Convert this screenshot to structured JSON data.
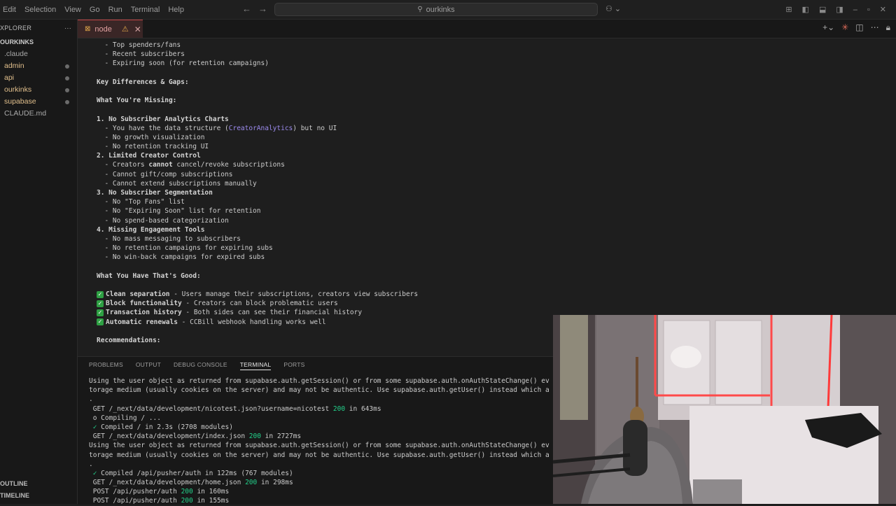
{
  "menu": [
    "Edit",
    "Selection",
    "View",
    "Go",
    "Run",
    "Terminal",
    "Help"
  ],
  "search": {
    "text": "ourkinks",
    "icon": "search-icon"
  },
  "explorer": {
    "title": "XPLORER",
    "more": "···",
    "root": "OURKINKS",
    "items": [
      {
        "label": ".claude",
        "modified": false
      },
      {
        "label": "admin",
        "modified": true
      },
      {
        "label": "api",
        "modified": true
      },
      {
        "label": "ourkinks",
        "modified": true
      },
      {
        "label": "supabase",
        "modified": true
      },
      {
        "label": "CLAUDE.md",
        "modified": false
      }
    ],
    "outline": "OUTLINE",
    "timeline": "TIMELINE"
  },
  "tab": {
    "label": "node"
  },
  "editor": {
    "l1": "  - Top spenders/fans",
    "l2": "  - Recent subscribers",
    "l3": "  - Expiring soon (for retention campaigns)",
    "h1": "Key Differences & Gaps:",
    "h2": "What You're Missing:",
    "s1": "1. No Subscriber Analytics Charts",
    "s1a_pre": "  - You have the data structure (",
    "s1a_link": "CreatorAnalytics",
    "s1a_post": ") but no UI",
    "s1b": "  - No growth visualization",
    "s1c": "  - No retention tracking UI",
    "s2": "2. Limited Creator Control",
    "s2a_pre": "  - Creators ",
    "s2a_bold": "cannot",
    "s2a_post": " cancel/revoke subscriptions",
    "s2b": "  - Cannot gift/comp subscriptions",
    "s2c": "  - Cannot extend subscriptions manually",
    "s3": "3. No Subscriber Segmentation",
    "s3a": "  - No \"Top Fans\" list",
    "s3b": "  - No \"Expiring Soon\" list for retention",
    "s3c": "  - No spend-based categorization",
    "s4": "4. Missing Engagement Tools",
    "s4a": "  - No mass messaging to subscribers",
    "s4b": "  - No retention campaigns for expiring subs",
    "s4c": "  - No win-back campaigns for expired subs",
    "h3": "What You Have That's Good:",
    "g1b": "Clean separation",
    "g1t": " - Users manage their subscriptions, creators view subscribers",
    "g2b": "Block functionality",
    "g2t": " - Creators can block problematic users",
    "g3b": "Transaction history",
    "g3t": " - Both sides can see their financial history",
    "g4b": "Automatic renewals",
    "g4t": " - CCBill webhook handling works well",
    "h4": "Recommendations:"
  },
  "panel": {
    "tabs": [
      "PROBLEMS",
      "OUTPUT",
      "DEBUG CONSOLE",
      "TERMINAL",
      "PORTS"
    ],
    "active_tab": "TERMINAL"
  },
  "terminal": {
    "t1": "Using the user object as returned from supabase.auth.getSession() or from some supabase.auth.onAuthStateChange() ev",
    "t2": "torage medium (usually cookies on the server) and may not be authentic. Use supabase.auth.getUser() instead which a",
    "t3": ".",
    "t4_pre": " GET /_next/data/development/nicotest.json?username=nicotest ",
    "t4_code": "200",
    "t4_post": " in 643ms",
    "t5": " o Compiling / ...",
    "t6_mark": " ✓",
    "t6_text": " Compiled / in 2.3s (2708 modules)",
    "t7_pre": " GET /_next/data/development/index.json ",
    "t7_code": "200",
    "t7_post": " in 2727ms",
    "t8": "Using the user object as returned from supabase.auth.getSession() or from some supabase.auth.onAuthStateChange() ev",
    "t9": "torage medium (usually cookies on the server) and may not be authentic. Use supabase.auth.getUser() instead which a",
    "t10": ".",
    "t11_mark": " ✓",
    "t11_text": " Compiled /api/pusher/auth in 122ms (767 modules)",
    "t12_pre": " GET /_next/data/development/home.json ",
    "t12_code": "200",
    "t12_post": " in 298ms",
    "t13_pre": " POST /api/pusher/auth ",
    "t13_code": "200",
    "t13_post": " in 160ms",
    "t14_pre": " POST /api/pusher/auth ",
    "t14_code": "200",
    "t14_post": " in 155ms"
  },
  "colors": {
    "accent_error": "#c34545",
    "success": "#23d18b",
    "link": "#9d8cf0"
  }
}
